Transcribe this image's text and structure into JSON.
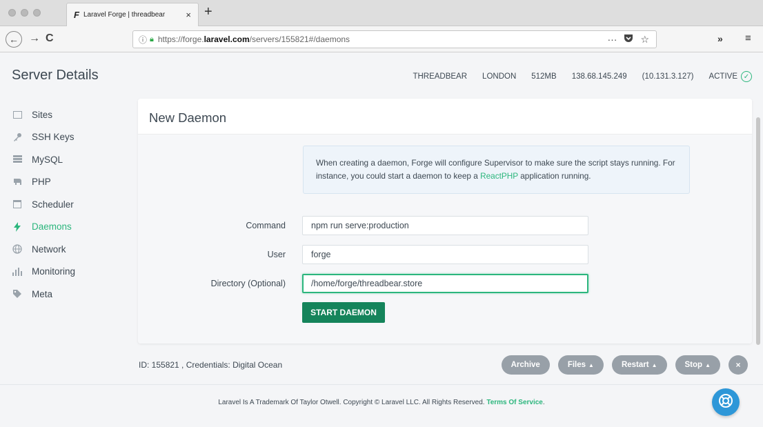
{
  "browser": {
    "tab_title": "Laravel Forge | threadbear",
    "tab_close": "×",
    "new_tab": "+",
    "url_prefix": "https://forge.",
    "url_domain": "laravel.com",
    "url_path": "/servers/155821#/daemons",
    "url_more": "···",
    "overflow": "»",
    "menu": "≡"
  },
  "header": {
    "title": "Server Details",
    "server_name": "THREADBEAR",
    "region": "LONDON",
    "memory": "512MB",
    "public_ip": "138.68.145.249",
    "private_ip": "(10.131.3.127)",
    "status": "ACTIVE"
  },
  "sidebar": {
    "items": [
      {
        "label": "Sites"
      },
      {
        "label": "SSH Keys"
      },
      {
        "label": "MySQL"
      },
      {
        "label": "PHP"
      },
      {
        "label": "Scheduler"
      },
      {
        "label": "Daemons"
      },
      {
        "label": "Network"
      },
      {
        "label": "Monitoring"
      },
      {
        "label": "Meta"
      }
    ]
  },
  "panel": {
    "title": "New Daemon",
    "notice_text_before": "When creating a daemon, Forge will configure Supervisor to make sure the script stays running. For instance, you could start a daemon to keep a ",
    "notice_link": "ReactPHP",
    "notice_text_after": " application running.",
    "command_label": "Command",
    "command_value": "npm run serve:production",
    "user_label": "User",
    "user_value": "forge",
    "directory_label": "Directory (Optional)",
    "directory_value": "/home/forge/threadbear.store",
    "submit_label": "START DAEMON"
  },
  "footer": {
    "meta": "ID: 155821 , Credentials: Digital Ocean",
    "archive": "Archive",
    "files": "Files",
    "restart": "Restart",
    "stop": "Stop",
    "close": "×",
    "copyright": "Laravel Is A Trademark Of Taylor Otwell. Copyright © Laravel LLC. All Rights Reserved. ",
    "tos": "Terms Of Service",
    "period": "."
  },
  "colors": {
    "accent": "#2cb67d",
    "primary_button": "#15845b",
    "help_button": "#2e97d8"
  }
}
